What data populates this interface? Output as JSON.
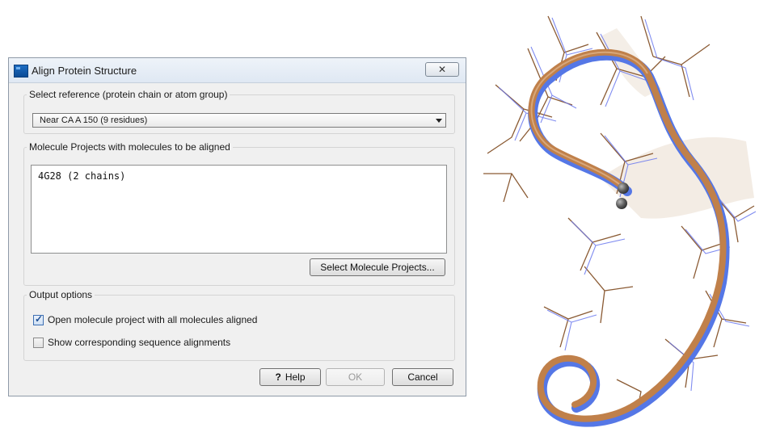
{
  "dialog": {
    "title": "Align Protein Structure",
    "close_symbol": "✕"
  },
  "reference": {
    "group_label": "Select reference (protein chain or atom group)",
    "selected": "Near CA A 150 (9 residues)"
  },
  "molecules": {
    "group_label": "Molecule Projects with molecules to be aligned",
    "items": [
      "4G28 (2 chains)"
    ],
    "select_button": "Select Molecule Projects..."
  },
  "output": {
    "group_label": "Output options",
    "open_project_label": "Open molecule project with all molecules aligned",
    "open_project_checked": true,
    "show_alignments_label": "Show corresponding sequence alignments",
    "show_alignments_checked": false
  },
  "buttons": {
    "help_icon": "?",
    "help": "Help",
    "ok": "OK",
    "cancel": "Cancel"
  },
  "colors": {
    "reference_chain": "#c0804a",
    "aligned_chain": "#5577e6"
  }
}
